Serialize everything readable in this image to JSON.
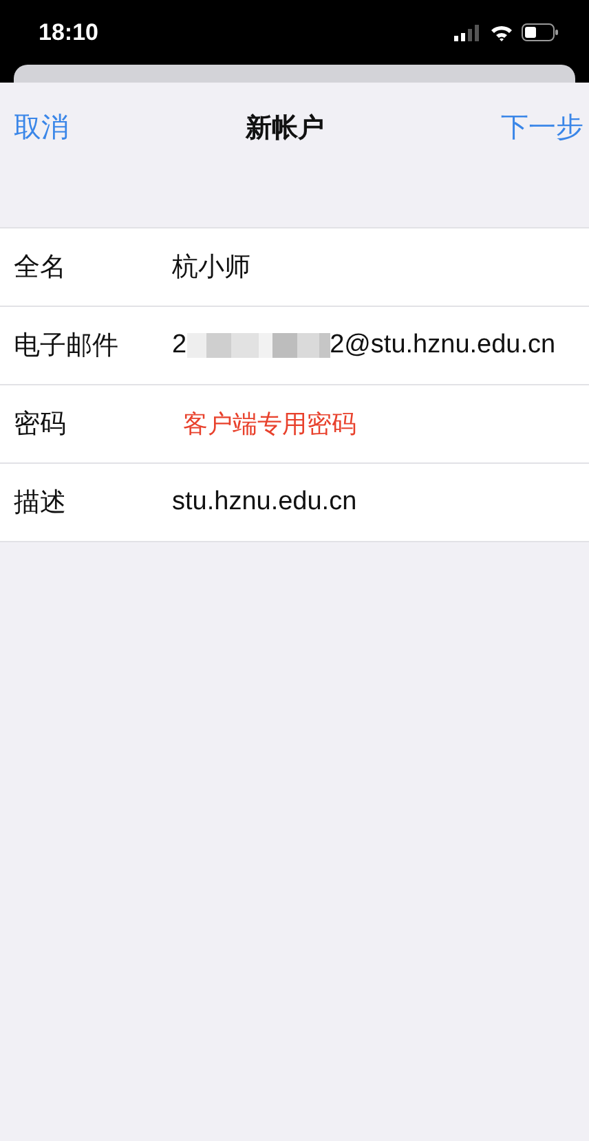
{
  "status_bar": {
    "time": "18:10"
  },
  "nav": {
    "cancel": "取消",
    "title": "新帐户",
    "next": "下一步"
  },
  "rows": [
    {
      "kind": "text",
      "label": "全名",
      "value": "杭小师"
    },
    {
      "kind": "redacted",
      "label": "电子邮件",
      "value_start": "2",
      "value_end": "2@stu.hznu.edu.cn"
    },
    {
      "kind": "note",
      "label": "密码",
      "note": "客户端专用密码",
      "color": "#e8412c"
    },
    {
      "kind": "text",
      "label": "描述",
      "value": "stu.hznu.edu.cn"
    }
  ]
}
